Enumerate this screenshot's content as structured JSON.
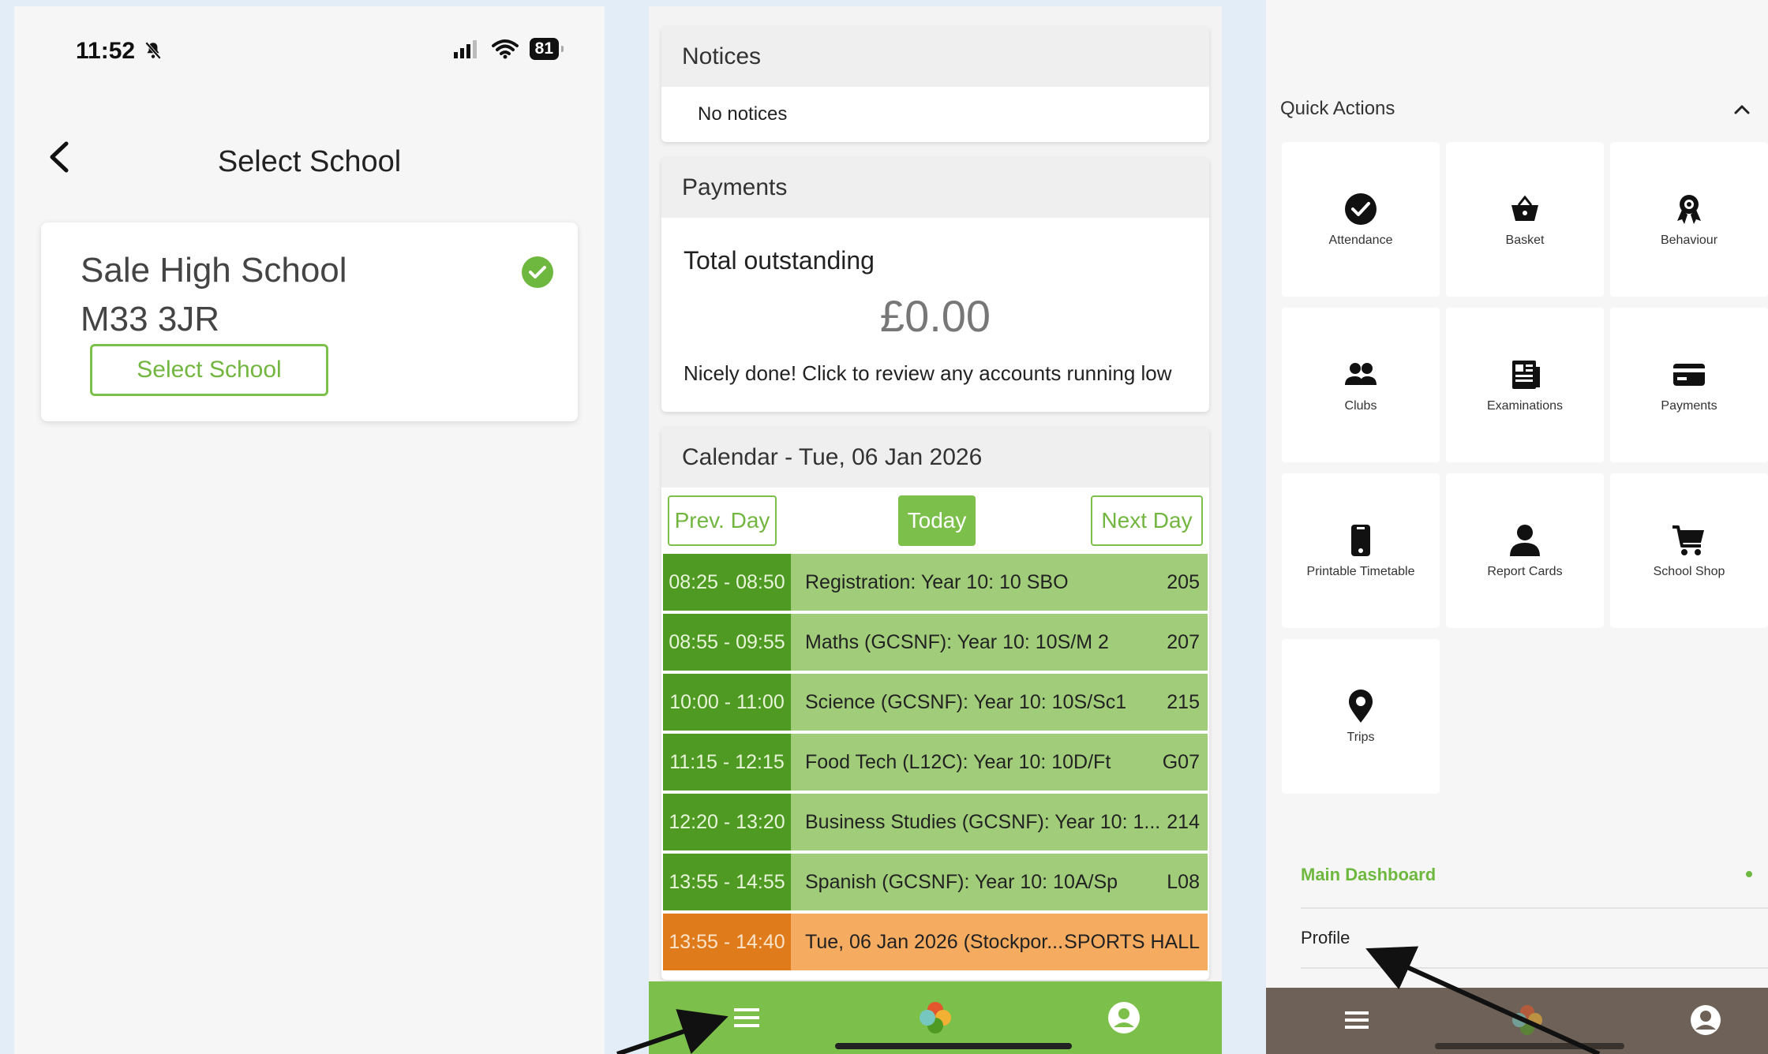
{
  "panel1": {
    "status_bar": {
      "time": "11:52",
      "battery": "81"
    },
    "title": "Select School",
    "school": {
      "name": "Sale High School",
      "postcode": "M33 3JR",
      "button_label": "Select School"
    }
  },
  "panel2": {
    "notices": {
      "title": "Notices",
      "body": "No notices"
    },
    "payments": {
      "title": "Payments",
      "label": "Total outstanding",
      "amount": "£0.00",
      "note": "Nicely done! Click to review any accounts running low"
    },
    "calendar": {
      "title": "Calendar - Tue, 06 Jan 2026",
      "prev_label": "Prev. Day",
      "today_label": "Today",
      "next_label": "Next Day",
      "rows": [
        {
          "time": "08:25 - 08:50",
          "subject": "Registration: Year 10: 10 SBO",
          "room": "205"
        },
        {
          "time": "08:55 - 09:55",
          "subject": "Maths (GCSNF): Year 10: 10S/M 2",
          "room": "207"
        },
        {
          "time": "10:00 - 11:00",
          "subject": "Science (GCSNF): Year 10: 10S/Sc1",
          "room": "215"
        },
        {
          "time": "11:15 - 12:15",
          "subject": "Food Tech (L12C): Year 10: 10D/Ft",
          "room": "G07"
        },
        {
          "time": "12:20 - 13:20",
          "subject": "Business Studies (GCSNF): Year 10: 1...",
          "room": "214"
        },
        {
          "time": "13:55 - 14:55",
          "subject": "Spanish (GCSNF): Year 10: 10A/Sp",
          "room": "L08"
        },
        {
          "time": "13:55 - 14:40",
          "subject": "Tue, 06 Jan 2026 (Stockpor...",
          "room": "SPORTS HALL"
        }
      ]
    },
    "colors": {
      "brand_green": "#7cc04b",
      "time_green": "#4f9a22",
      "row_green": "#a1cc79",
      "event_orange": "#f5ac61"
    }
  },
  "panel3": {
    "quick_actions_title": "Quick Actions",
    "tiles": [
      {
        "label": "Attendance",
        "icon": "check-circle-icon"
      },
      {
        "label": "Basket",
        "icon": "basket-icon"
      },
      {
        "label": "Behaviour",
        "icon": "award-icon"
      },
      {
        "label": "Clubs",
        "icon": "people-icon"
      },
      {
        "label": "Examinations",
        "icon": "newspaper-icon"
      },
      {
        "label": "Payments",
        "icon": "card-icon"
      },
      {
        "label": "Printable Timetable",
        "icon": "phone-icon"
      },
      {
        "label": "Report Cards",
        "icon": "person-icon"
      },
      {
        "label": "School Shop",
        "icon": "cart-icon"
      },
      {
        "label": "Trips",
        "icon": "map-pin-icon"
      }
    ],
    "menu": {
      "main_dashboard": "Main Dashboard",
      "profile": "Profile"
    },
    "colors": {
      "nav_brown": "#6e6258",
      "active_green": "#6fb83f"
    }
  }
}
